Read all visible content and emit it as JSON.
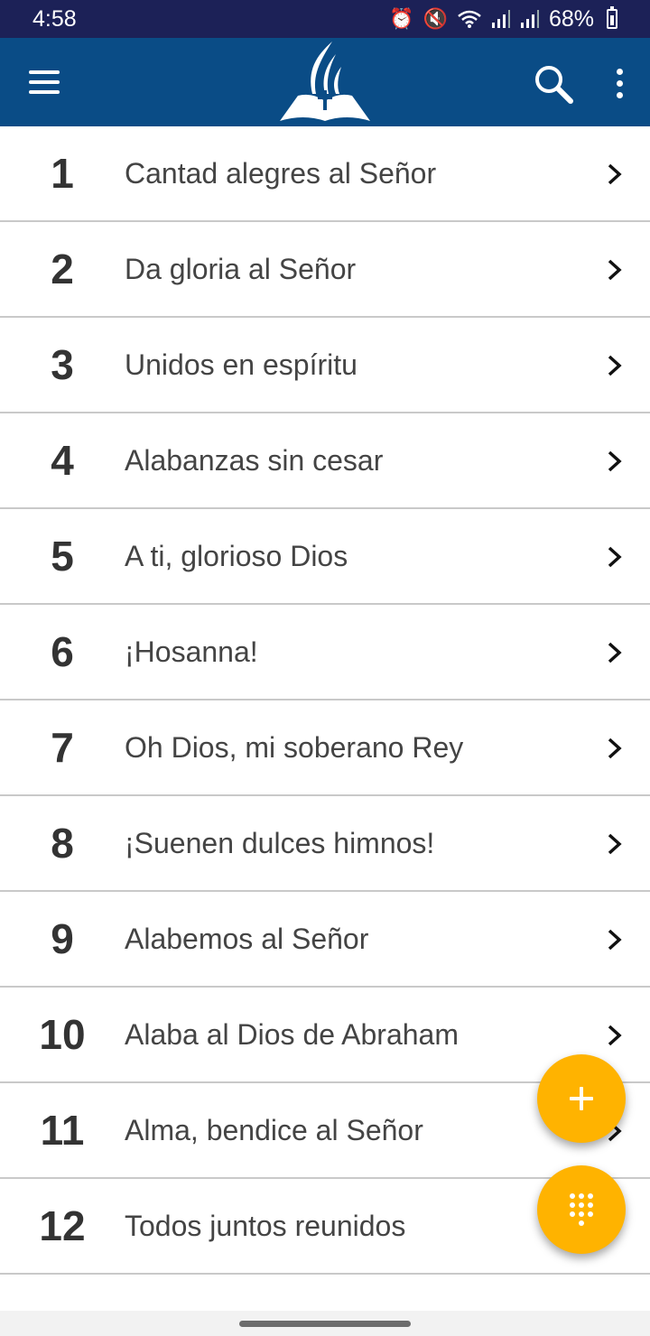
{
  "status_bar": {
    "time": "4:58",
    "battery_text": "68%",
    "icons": [
      "alarm-icon",
      "mute-icon",
      "wifi-icon",
      "signal-icon",
      "signal-icon",
      "battery-icon"
    ]
  },
  "app_bar": {
    "menu_icon": "hamburger-menu-icon",
    "logo": "church-logo",
    "search_icon": "search-icon",
    "more_icon": "more-vertical-icon",
    "background_color": "#0a4c86"
  },
  "hymns": [
    {
      "number": "1",
      "title": "Cantad alegres al Señor"
    },
    {
      "number": "2",
      "title": "Da gloria al Señor"
    },
    {
      "number": "3",
      "title": "Unidos en espíritu"
    },
    {
      "number": "4",
      "title": "Alabanzas sin cesar"
    },
    {
      "number": "5",
      "title": "A ti, glorioso Dios"
    },
    {
      "number": "6",
      "title": "¡Hosanna!"
    },
    {
      "number": "7",
      "title": "Oh Dios, mi soberano Rey"
    },
    {
      "number": "8",
      "title": "¡Suenen dulces himnos!"
    },
    {
      "number": "9",
      "title": "Alabemos al Señor"
    },
    {
      "number": "10",
      "title": "Alaba al Dios de Abraham"
    },
    {
      "number": "11",
      "title": "Alma, bendice al Señor"
    },
    {
      "number": "12",
      "title": "Todos juntos reunidos"
    }
  ],
  "fabs": {
    "add_icon": "plus-icon",
    "dialpad_icon": "dialpad-icon",
    "color": "#ffb300"
  }
}
